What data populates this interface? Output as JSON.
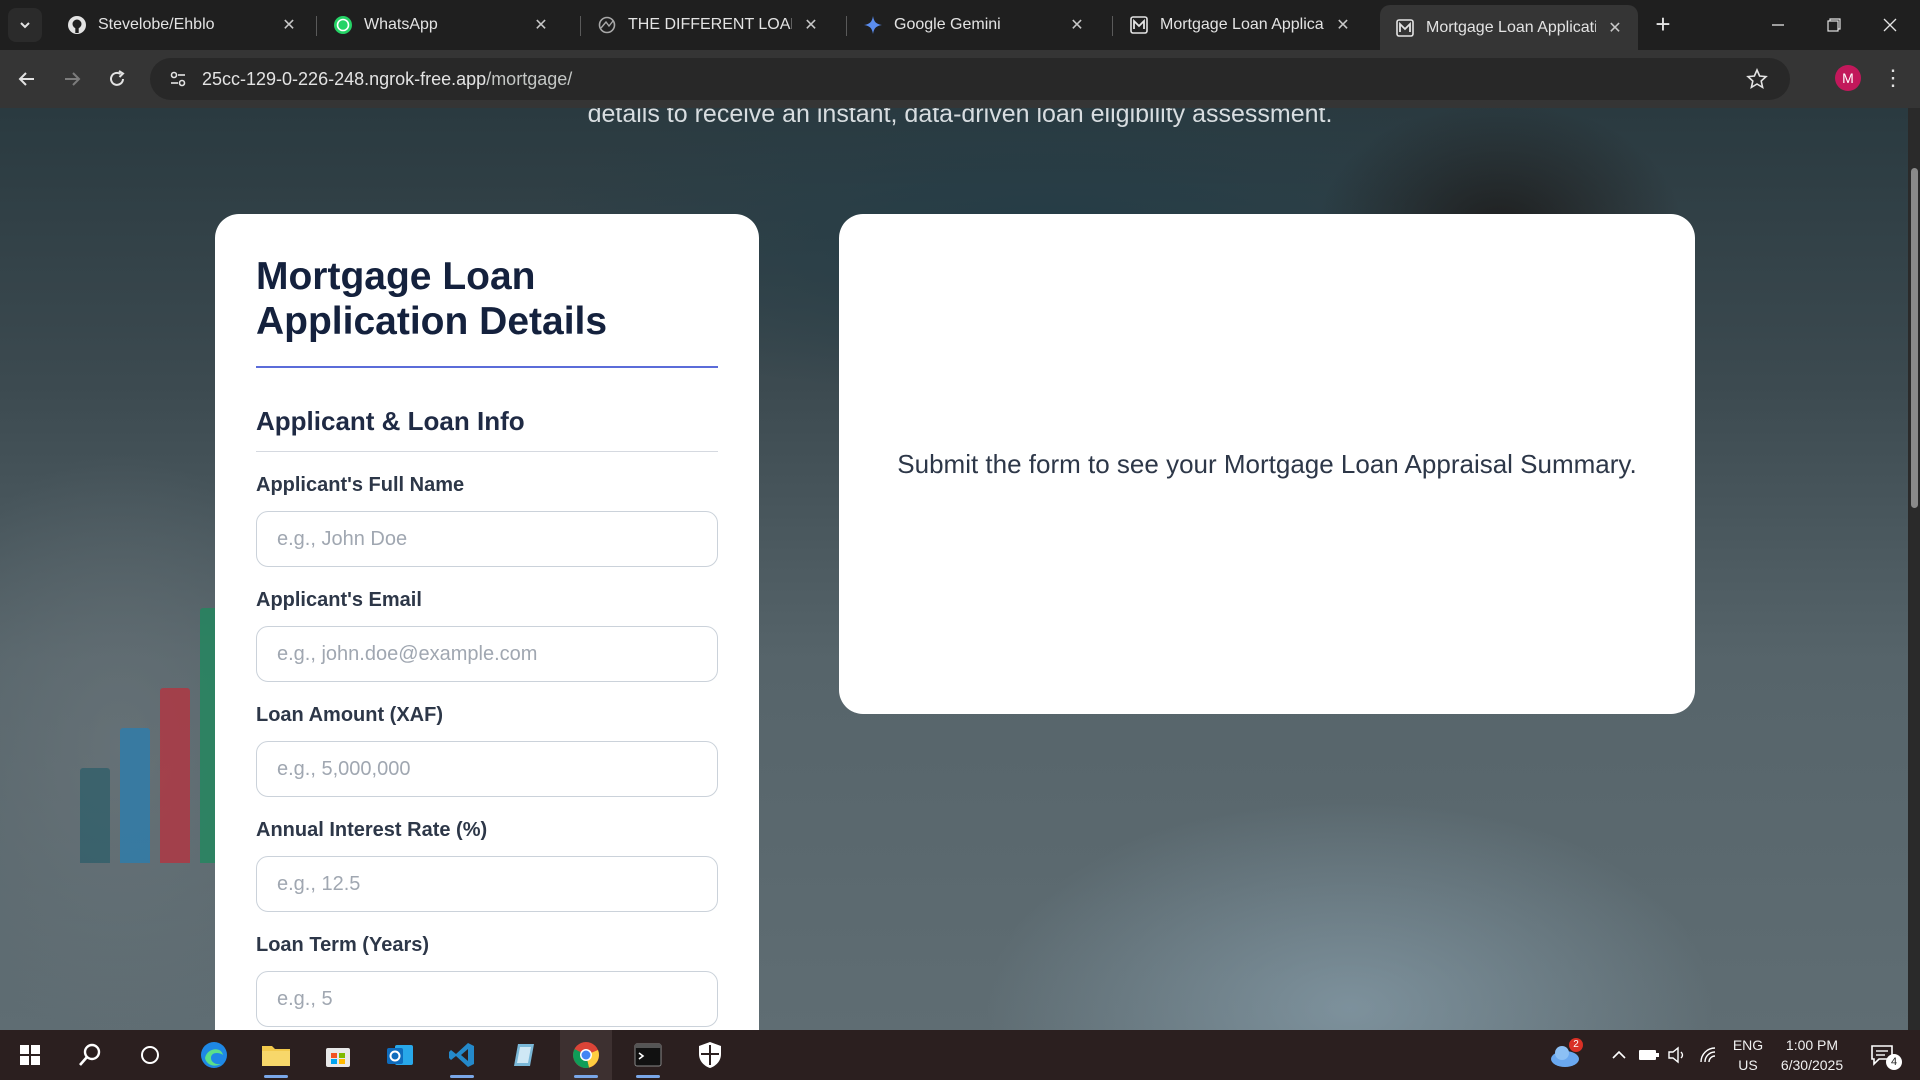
{
  "browser": {
    "tabs": [
      {
        "title": "Stevelobe/Ehblo",
        "icon": "github-icon",
        "active": false
      },
      {
        "title": "WhatsApp",
        "icon": "whatsapp-icon",
        "active": false
      },
      {
        "title": "THE DIFFERENT LOAN DAS",
        "icon": "globe-icon",
        "active": false
      },
      {
        "title": "Google Gemini",
        "icon": "gemini-icon",
        "active": false
      },
      {
        "title": "Mortgage Loan Applicatio",
        "icon": "mortgage-app-icon",
        "active": false
      },
      {
        "title": "Mortgage Loan Applicatio",
        "icon": "mortgage-app-icon",
        "active": true
      }
    ],
    "url_host": "25cc-129-0-226-248.ngrok-free.app",
    "url_path": "/mortgage/",
    "profile_initial": "M"
  },
  "page": {
    "hero_text": "details to receive an instant, data-driven loan eligibility assessment.",
    "form": {
      "title": "Mortgage Loan Application Details",
      "section_title": "Applicant & Loan Info",
      "fields": [
        {
          "label": "Applicant's Full Name",
          "placeholder": "e.g., John Doe",
          "value": ""
        },
        {
          "label": "Applicant's Email",
          "placeholder": "e.g., john.doe@example.com",
          "value": ""
        },
        {
          "label": "Loan Amount (XAF)",
          "placeholder": "e.g., 5,000,000",
          "value": ""
        },
        {
          "label": "Annual Interest Rate (%)",
          "placeholder": "e.g., 12.5",
          "value": ""
        },
        {
          "label": "Loan Term (Years)",
          "placeholder": "e.g., 5",
          "value": ""
        }
      ]
    },
    "summary_placeholder": "Submit the form to see your Mortgage Loan Appraisal Summary."
  },
  "taskbar": {
    "weather_badge": "2",
    "language": "ENG",
    "region": "US",
    "time": "1:00 PM",
    "date": "6/30/2025",
    "notifications": "4"
  },
  "colors": {
    "accent_rule": "#5b6cd9",
    "title_text": "#14213d",
    "card_bg": "#ffffff"
  }
}
